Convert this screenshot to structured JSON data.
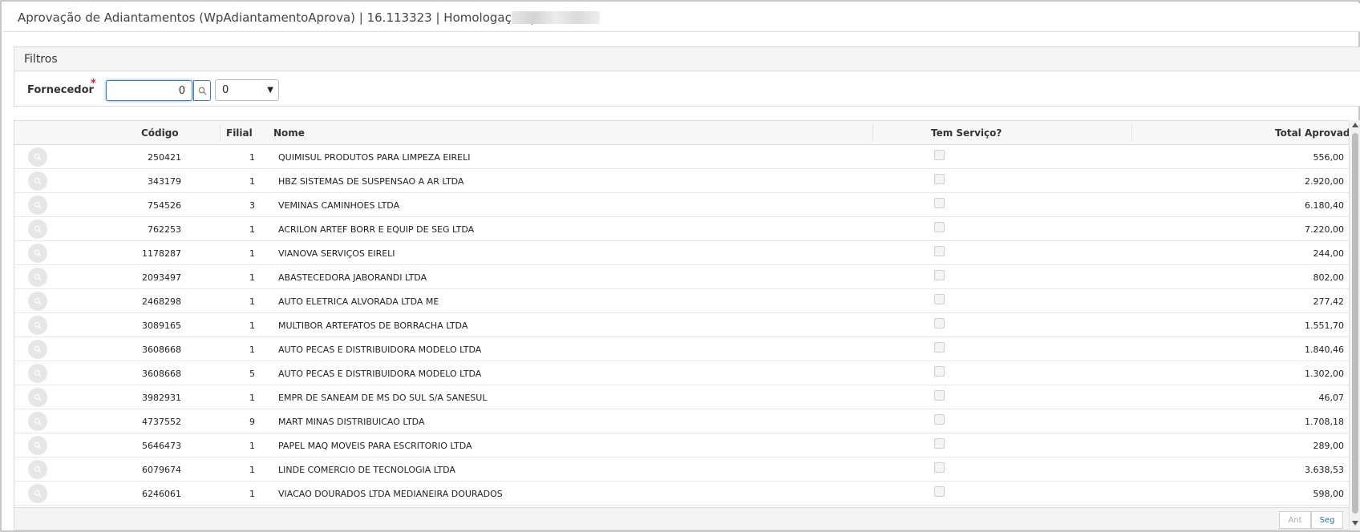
{
  "window": {
    "title": "Aprovação de Adiantamentos (WpAdiantamentoAprova) | 16.113323 | Homologação |"
  },
  "filters": {
    "title": "Filtros",
    "fornecedor_label": "Fornecedor",
    "required_mark": "*",
    "fornecedor_value": "0",
    "select_value": "0",
    "lookup_icon": "search-icon"
  },
  "grid": {
    "columns": [
      "Código",
      "Filial",
      "Nome",
      "Tem Serviço?",
      "Total Aprovado"
    ],
    "rows": [
      {
        "codigo": "250421",
        "filial": "1",
        "nome": "QUIMISUL PRODUTOS PARA LIMPEZA EIRELI",
        "tem_servico": false,
        "total": "556,00"
      },
      {
        "codigo": "343179",
        "filial": "1",
        "nome": "HBZ SISTEMAS DE SUSPENSAO A AR LTDA",
        "tem_servico": false,
        "total": "2.920,00"
      },
      {
        "codigo": "754526",
        "filial": "3",
        "nome": "VEMINAS CAMINHOES LTDA",
        "tem_servico": false,
        "total": "6.180,40"
      },
      {
        "codigo": "762253",
        "filial": "1",
        "nome": "ACRILON ARTEF BORR E EQUIP DE SEG LTDA",
        "tem_servico": false,
        "total": "7.220,00"
      },
      {
        "codigo": "1178287",
        "filial": "1",
        "nome": "VIANOVA SERVIÇOS EIRELI",
        "tem_servico": false,
        "total": "244,00"
      },
      {
        "codigo": "2093497",
        "filial": "1",
        "nome": "ABASTECEDORA JABORANDI LTDA",
        "tem_servico": false,
        "total": "802,00"
      },
      {
        "codigo": "2468298",
        "filial": "1",
        "nome": "AUTO ELETRICA ALVORADA LTDA ME",
        "tem_servico": false,
        "total": "277,42"
      },
      {
        "codigo": "3089165",
        "filial": "1",
        "nome": "MULTIBOR ARTEFATOS DE BORRACHA LTDA",
        "tem_servico": false,
        "total": "1.551,70"
      },
      {
        "codigo": "3608668",
        "filial": "1",
        "nome": "AUTO PECAS E DISTRIBUIDORA MODELO LTDA",
        "tem_servico": false,
        "total": "1.840,46"
      },
      {
        "codigo": "3608668",
        "filial": "5",
        "nome": "AUTO PECAS E DISTRIBUIDORA MODELO LTDA",
        "tem_servico": false,
        "total": "1.302,00"
      },
      {
        "codigo": "3982931",
        "filial": "1",
        "nome": "EMPR DE SANEAM DE MS DO SUL S/A SANESUL",
        "tem_servico": false,
        "total": "46,07"
      },
      {
        "codigo": "4737552",
        "filial": "9",
        "nome": "MART MINAS DISTRIBUICAO LTDA",
        "tem_servico": false,
        "total": "1.708,18"
      },
      {
        "codigo": "5646473",
        "filial": "1",
        "nome": "PAPEL MAQ MOVEIS PARA ESCRITORIO LTDA",
        "tem_servico": false,
        "total": "289,00"
      },
      {
        "codigo": "6079674",
        "filial": "1",
        "nome": "LINDE COMERCIO DE TECNOLOGIA LTDA",
        "tem_servico": false,
        "total": "3.638,53"
      },
      {
        "codigo": "6246061",
        "filial": "1",
        "nome": "VIACAO DOURADOS LTDA MEDIANEIRA DOURADOS",
        "tem_servico": false,
        "total": "598,00"
      }
    ],
    "row_action_icon": "view-icon"
  },
  "pagination": {
    "prev_label": "Ant",
    "next_label": "Seg"
  },
  "colors": {
    "focus_border": "#3d7bd8",
    "required": "#e02020",
    "link": "#2a6ab8"
  }
}
